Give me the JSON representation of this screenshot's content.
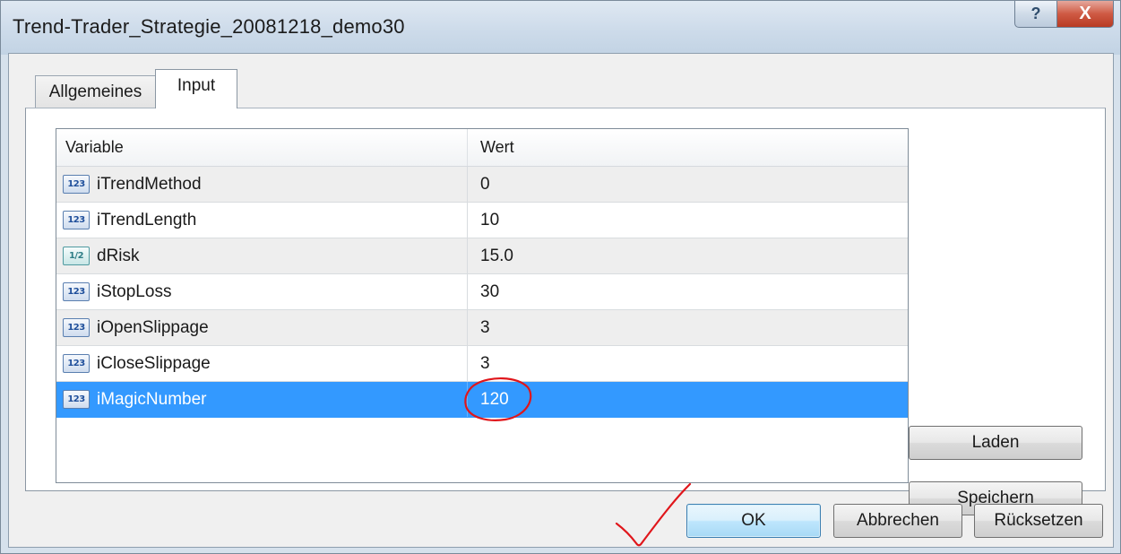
{
  "window": {
    "title": "Trend-Trader_Strategie_20081218_demo30",
    "help_glyph": "?",
    "close_glyph": "X"
  },
  "tabs": [
    {
      "label": "Allgemeines",
      "active": false
    },
    {
      "label": "Input",
      "active": true
    }
  ],
  "table": {
    "columns": [
      "Variable",
      "Wert"
    ],
    "rows": [
      {
        "icon": "integer-icon",
        "icon_text": "123",
        "variable": "iTrendMethod",
        "value": "0"
      },
      {
        "icon": "integer-icon",
        "icon_text": "123",
        "variable": "iTrendLength",
        "value": "10"
      },
      {
        "icon": "double-icon",
        "icon_text": "1/2",
        "variable": "dRisk",
        "value": "15.0"
      },
      {
        "icon": "integer-icon",
        "icon_text": "123",
        "variable": "iStopLoss",
        "value": "30"
      },
      {
        "icon": "integer-icon",
        "icon_text": "123",
        "variable": "iOpenSlippage",
        "value": "3"
      },
      {
        "icon": "integer-icon",
        "icon_text": "123",
        "variable": "iCloseSlippage",
        "value": "3"
      },
      {
        "icon": "integer-icon",
        "icon_text": "123",
        "variable": "iMagicNumber",
        "value": "120",
        "selected": true
      }
    ]
  },
  "buttons": {
    "load": "Laden",
    "save": "Speichern",
    "ok": "OK",
    "cancel": "Abbrechen",
    "reset": "Rücksetzen"
  },
  "colors": {
    "selection": "#3399ff",
    "annotation": "#e0161b"
  }
}
